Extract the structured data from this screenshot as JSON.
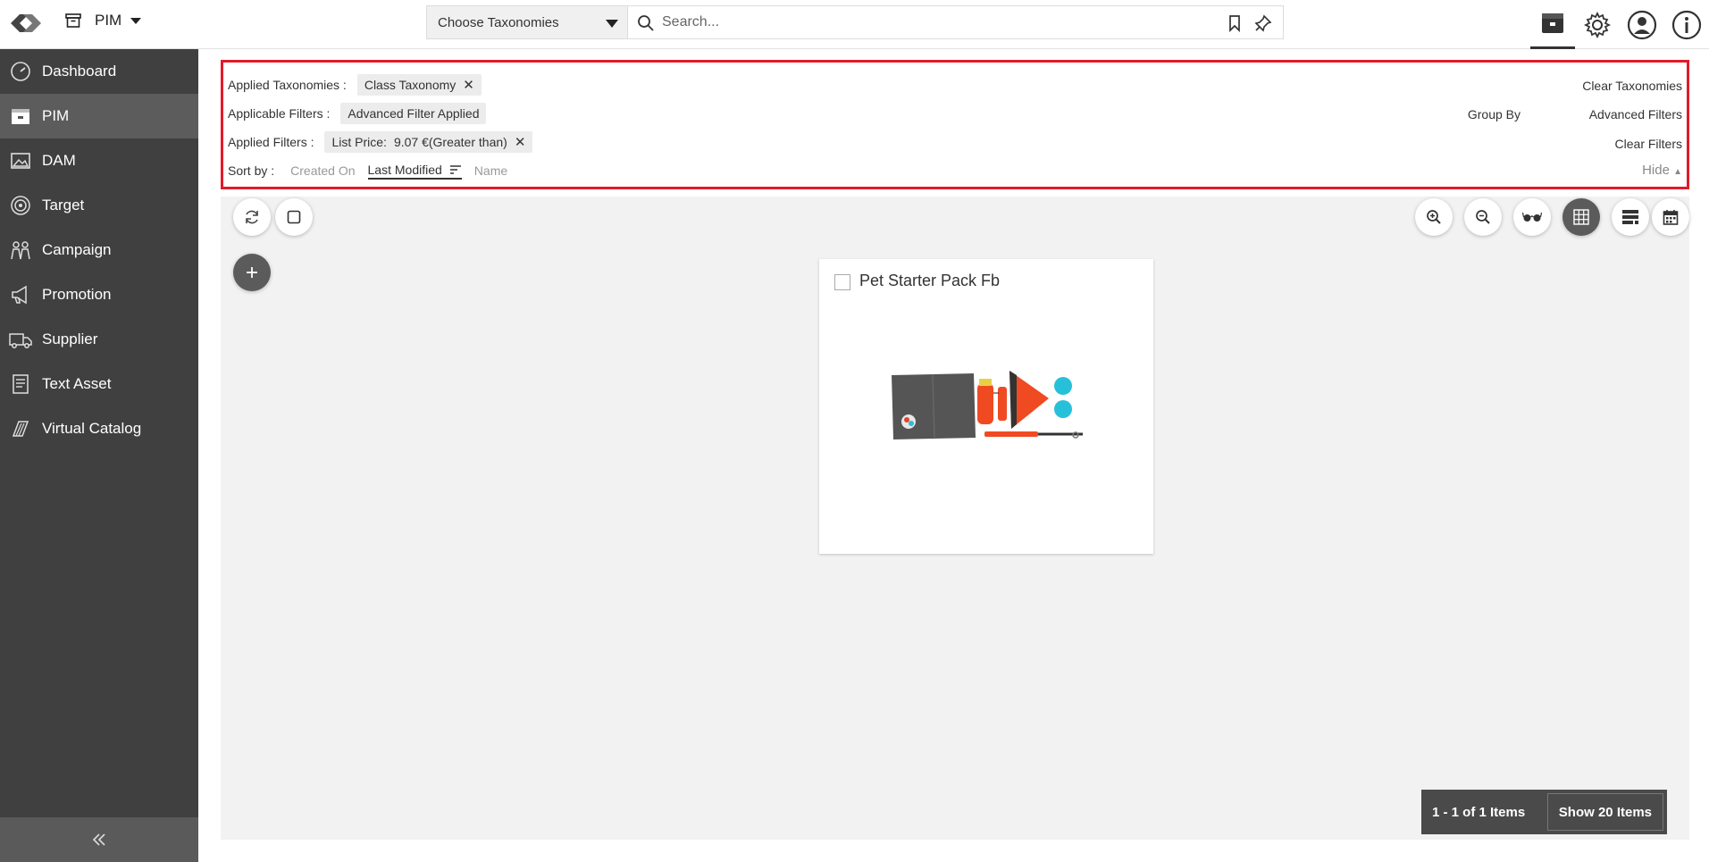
{
  "header": {
    "app_name": "PIM",
    "taxonomy_select": "Choose Taxonomies",
    "search_placeholder": "Search..."
  },
  "sidebar": {
    "items": [
      {
        "label": "Dashboard",
        "icon": "dashboard-icon"
      },
      {
        "label": "PIM",
        "icon": "pim-icon",
        "active": true
      },
      {
        "label": "DAM",
        "icon": "image-icon"
      },
      {
        "label": "Target",
        "icon": "target-icon"
      },
      {
        "label": "Campaign",
        "icon": "campaign-icon"
      },
      {
        "label": "Promotion",
        "icon": "megaphone-icon"
      },
      {
        "label": "Supplier",
        "icon": "truck-icon"
      },
      {
        "label": "Text Asset",
        "icon": "document-icon"
      },
      {
        "label": "Virtual Catalog",
        "icon": "catalog-icon"
      }
    ]
  },
  "filters": {
    "applied_taxonomies_label": "Applied Taxonomies :",
    "taxonomy_chip": "Class Taxonomy",
    "clear_taxonomies": "Clear Taxonomies",
    "applicable_filters_label": "Applicable Filters :",
    "applicable_chip": "Advanced Filter Applied",
    "group_by": "Group By",
    "advanced_filters": "Advanced Filters",
    "applied_filters_label": "Applied Filters :",
    "filter_chip_name": "List Price:",
    "filter_chip_value": "9.07 €(Greater than)",
    "clear_filters": "Clear Filters",
    "sort_by_label": "Sort by :",
    "sort_options": [
      "Created On",
      "Last Modified",
      "Name"
    ],
    "hide": "Hide"
  },
  "products": [
    {
      "title": "Pet Starter Pack Fb"
    }
  ],
  "pager": {
    "count": "1 - 1 of 1 Items",
    "show": "Show 20 Items"
  }
}
